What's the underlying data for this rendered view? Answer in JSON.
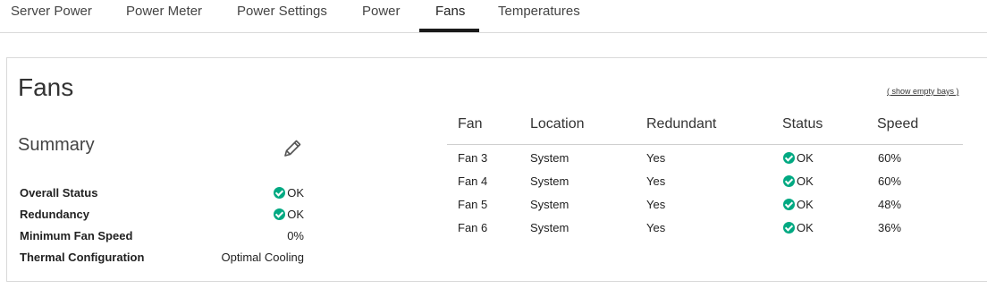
{
  "tabs": [
    {
      "label": "Server Power"
    },
    {
      "label": "Power Meter"
    },
    {
      "label": "Power Settings"
    },
    {
      "label": "Power"
    },
    {
      "label": "Fans",
      "active": true
    },
    {
      "label": "Temperatures"
    }
  ],
  "page": {
    "title": "Fans",
    "show_empty_link": "( show empty bays )"
  },
  "summary": {
    "title": "Summary",
    "rows": [
      {
        "label": "Overall Status",
        "value": "OK",
        "status_icon": "ok-icon"
      },
      {
        "label": "Redundancy",
        "value": "OK",
        "status_icon": "ok-icon"
      },
      {
        "label": "Minimum Fan Speed",
        "value": "0%"
      },
      {
        "label": "Thermal Configuration",
        "value": "Optimal Cooling"
      }
    ]
  },
  "fan_table": {
    "columns": [
      "Fan",
      "Location",
      "Redundant",
      "Status",
      "Speed"
    ],
    "rows": [
      {
        "fan": "Fan 3",
        "location": "System",
        "redundant": "Yes",
        "status": "OK",
        "speed": "60%"
      },
      {
        "fan": "Fan 4",
        "location": "System",
        "redundant": "Yes",
        "status": "OK",
        "speed": "60%"
      },
      {
        "fan": "Fan 5",
        "location": "System",
        "redundant": "Yes",
        "status": "OK",
        "speed": "48%"
      },
      {
        "fan": "Fan 6",
        "location": "System",
        "redundant": "Yes",
        "status": "OK",
        "speed": "36%"
      }
    ]
  },
  "colors": {
    "ok_green": "#01a982",
    "active_tab_underline": "#1a1a1a"
  }
}
